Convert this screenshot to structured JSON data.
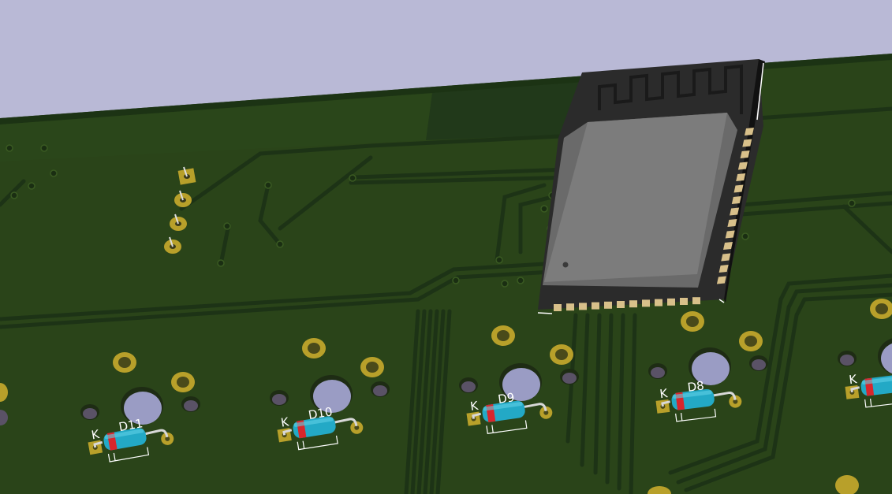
{
  "scene": {
    "background_color": "#b9b9d6",
    "board_color": "#2a4419",
    "board_edge_color": "#1c3314",
    "trace_color": "#1d3316",
    "pad_color": "#b8a02a",
    "silk_color": "#ffffff",
    "module_pcb_color": "#2b2b2b",
    "module_shield_color": "#7c7c7c",
    "module_pin_color": "#d8c08a",
    "diode_body_color": "#23a9c6",
    "diode_band_color": "#d8262c"
  },
  "module": {
    "component": "wifi-module",
    "antenna": "pcb-antenna"
  },
  "diodes": [
    {
      "ref": "D11",
      "cathode_label": "K"
    },
    {
      "ref": "D10",
      "cathode_label": "K"
    },
    {
      "ref": "D9",
      "cathode_label": "K"
    },
    {
      "ref": "D8",
      "cathode_label": "K"
    },
    {
      "ref": "",
      "cathode_label": "K"
    }
  ]
}
